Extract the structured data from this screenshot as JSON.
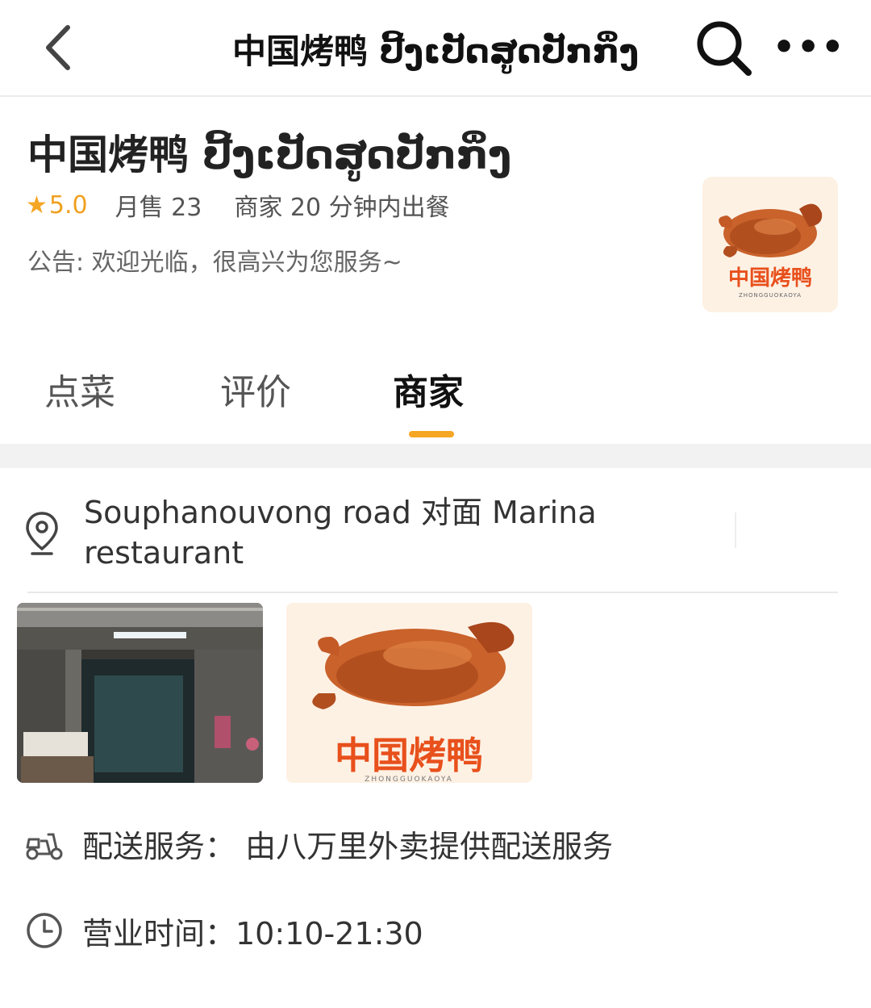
{
  "nav": {
    "title": "中国烤鸭 ປີ້ງເປັດສູດປັກກິ່ງ",
    "back_icon": "chevron-left-icon",
    "search_icon": "search-icon",
    "more_label": "•••"
  },
  "shop": {
    "name": "中国烤鸭 ປີ້ງເປັດສູດປັກກິ່ງ",
    "rating": "5.0",
    "monthly_sales": "月售 23",
    "prep_time": "商家 20 分钟内出餐",
    "notice": "公告: 欢迎光临，很高兴为您服务~",
    "logo_text": "中国烤鸭",
    "logo_subtext": "ZHONGGUOKAOYA"
  },
  "tabs": [
    {
      "label": "点菜",
      "active": false
    },
    {
      "label": "评价",
      "active": false
    },
    {
      "label": "商家",
      "active": true
    }
  ],
  "address": {
    "icon": "location-pin-icon",
    "text": "Souphanouvong road 对面 Marina restaurant"
  },
  "photos": {
    "logo_text": "中国烤鸭",
    "logo_subtext": "ZHONGGUOKAOYA"
  },
  "delivery": {
    "icon": "scooter-icon",
    "text": "配送服务： 由八万里外卖提供配送服务"
  },
  "hours": {
    "icon": "clock-icon",
    "text": "营业时间：10:10-21:30"
  },
  "colors": {
    "accent": "#f5a623",
    "logo_red": "#e8501c"
  }
}
